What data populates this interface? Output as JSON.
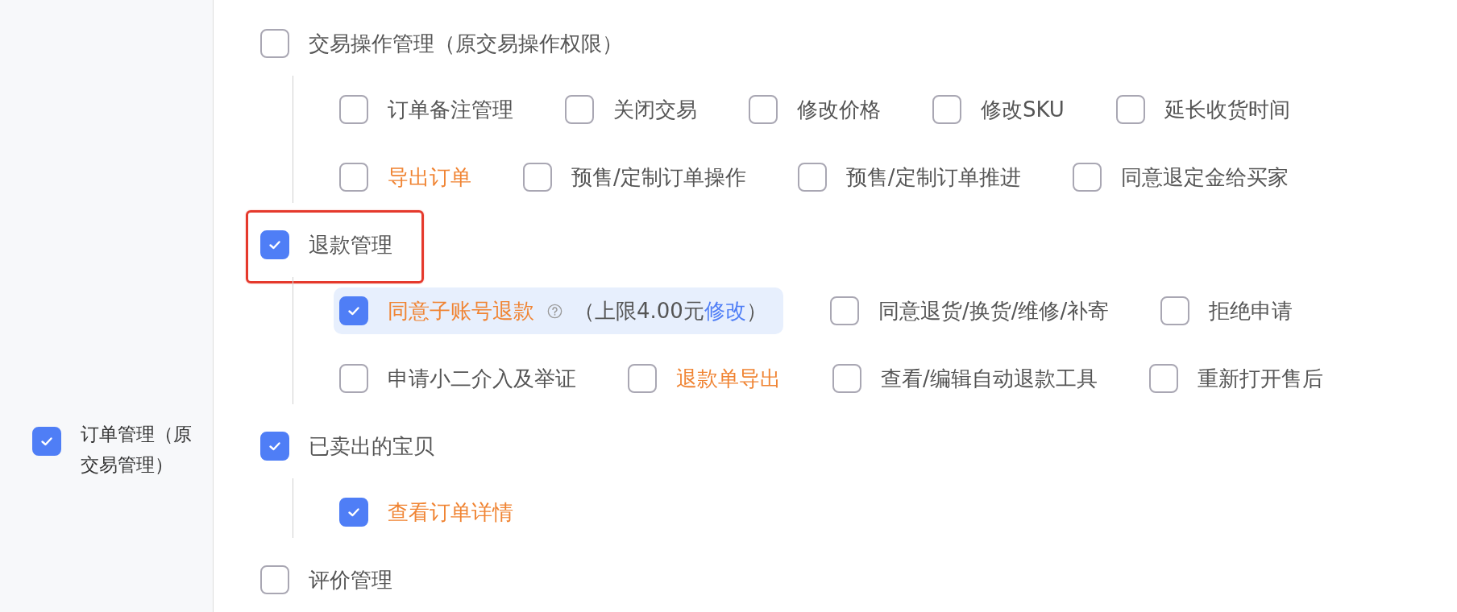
{
  "sidebar": {
    "item": {
      "label": "订单管理（原交易管理）",
      "checked": true
    }
  },
  "groups": [
    {
      "label": "交易操作管理（原交易操作权限）",
      "checked": false,
      "outlined": false,
      "lines": [
        {
          "options": [
            {
              "label": "订单备注管理",
              "checked": false,
              "emphasis": false,
              "highlighted": false
            },
            {
              "label": "关闭交易",
              "checked": false,
              "emphasis": false,
              "highlighted": false
            },
            {
              "label": "修改价格",
              "checked": false,
              "emphasis": false,
              "highlighted": false
            },
            {
              "label": "修改SKU",
              "checked": false,
              "emphasis": false,
              "highlighted": false
            },
            {
              "label": "延长收货时间",
              "checked": false,
              "emphasis": false,
              "highlighted": false
            }
          ]
        },
        {
          "options": [
            {
              "label": "导出订单",
              "checked": false,
              "emphasis": true,
              "highlighted": false
            },
            {
              "label": "预售/定制订单操作",
              "checked": false,
              "emphasis": false,
              "highlighted": false
            },
            {
              "label": "预售/定制订单推进",
              "checked": false,
              "emphasis": false,
              "highlighted": false
            },
            {
              "label": "同意退定金给买家",
              "checked": false,
              "emphasis": false,
              "highlighted": false
            }
          ]
        }
      ]
    },
    {
      "label": "退款管理",
      "checked": true,
      "outlined": true,
      "lines": [
        {
          "options": [
            {
              "label": "同意子账号退款",
              "checked": true,
              "emphasis": true,
              "highlighted": true,
              "note": "（上限4.00元",
              "note_link": "修改",
              "note_end": "）"
            },
            {
              "label": "同意退货/换货/维修/补寄",
              "checked": false,
              "emphasis": false,
              "highlighted": false
            },
            {
              "label": "拒绝申请",
              "checked": false,
              "emphasis": false,
              "highlighted": false
            }
          ]
        },
        {
          "options": [
            {
              "label": "申请小二介入及举证",
              "checked": false,
              "emphasis": false,
              "highlighted": false
            },
            {
              "label": "退款单导出",
              "checked": false,
              "emphasis": true,
              "highlighted": false
            },
            {
              "label": "查看/编辑自动退款工具",
              "checked": false,
              "emphasis": false,
              "highlighted": false
            },
            {
              "label": "重新打开售后",
              "checked": false,
              "emphasis": false,
              "highlighted": false
            }
          ]
        }
      ]
    },
    {
      "label": "已卖出的宝贝",
      "checked": true,
      "outlined": false,
      "lines": [
        {
          "options": [
            {
              "label": "查看订单详情",
              "checked": true,
              "emphasis": true,
              "highlighted": false
            }
          ]
        }
      ]
    },
    {
      "label": "评价管理",
      "checked": false,
      "outlined": false
    }
  ]
}
